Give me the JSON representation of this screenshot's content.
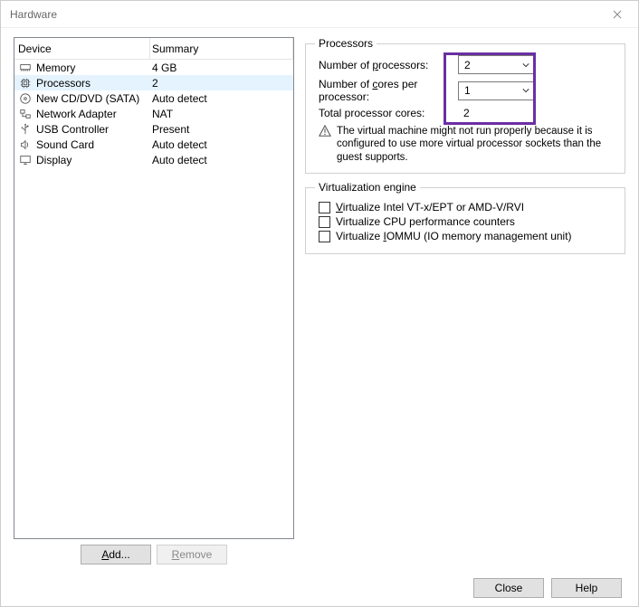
{
  "window": {
    "title": "Hardware"
  },
  "deviceList": {
    "headers": {
      "device": "Device",
      "summary": "Summary"
    },
    "rows": [
      {
        "name": "Memory",
        "summary": "4 GB",
        "icon": "memory-icon",
        "selected": false
      },
      {
        "name": "Processors",
        "summary": "2",
        "icon": "processor-icon",
        "selected": true
      },
      {
        "name": "New CD/DVD (SATA)",
        "summary": "Auto detect",
        "icon": "cd-icon",
        "selected": false
      },
      {
        "name": "Network Adapter",
        "summary": "NAT",
        "icon": "network-icon",
        "selected": false
      },
      {
        "name": "USB Controller",
        "summary": "Present",
        "icon": "usb-icon",
        "selected": false
      },
      {
        "name": "Sound Card",
        "summary": "Auto detect",
        "icon": "sound-icon",
        "selected": false
      },
      {
        "name": "Display",
        "summary": "Auto detect",
        "icon": "display-icon",
        "selected": false
      }
    ],
    "buttons": {
      "add": "Add...",
      "remove": "Remove"
    }
  },
  "processors": {
    "legend": "Processors",
    "numProcessorsLabel_pre": "Number of ",
    "numProcessorsLabel_u": "p",
    "numProcessorsLabel_post": "rocessors:",
    "numProcessorsValue": "2",
    "coresLabel_pre": "Number of ",
    "coresLabel_u": "c",
    "coresLabel_post": "ores per processor:",
    "coresValue": "1",
    "totalLabel": "Total processor cores:",
    "totalValue": "2",
    "warning": "The virtual machine might not run properly because it is configured to use more virtual processor sockets than the guest supports."
  },
  "virtEngine": {
    "legend": "Virtualization engine",
    "opt1_pre": "",
    "opt1_u": "V",
    "opt1_post": "irtualize Intel VT-x/EPT or AMD-V/RVI",
    "opt2": "Virtualize CPU performance counters",
    "opt3_pre": "Virtualize ",
    "opt3_u": "I",
    "opt3_post": "OMMU (IO memory management unit)"
  },
  "footer": {
    "close": "Close",
    "help": "Help"
  },
  "addBtnUnderline": "A",
  "addBtnRest": "dd...",
  "removeBtnUnderline": "R",
  "removeBtnRest": "emove"
}
